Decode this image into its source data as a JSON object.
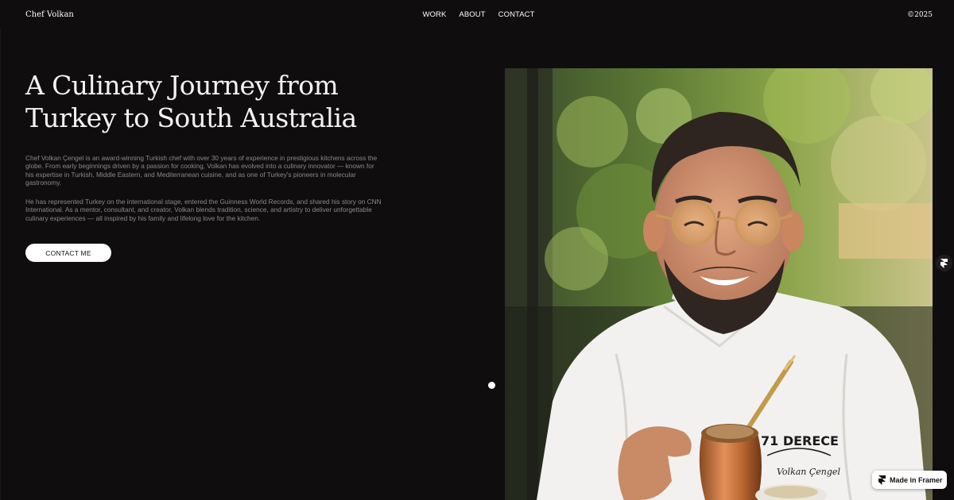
{
  "header": {
    "brand": "Chef Volkan",
    "nav": [
      "WORK",
      "ABOUT",
      "CONTACT"
    ],
    "year": "©2025"
  },
  "hero": {
    "title_line1": "A Culinary Journey from",
    "title_line2": "Turkey to South Australia",
    "bio_paragraph_1": "Chef Volkan Çengel is an award-winning Turkish chef with over 30 years of experience in prestigious kitchens across the globe. From early beginnings driven by a passion for cooking, Volkan has evolved into a culinary innovator — known for his expertise in Turkish, Middle Eastern, and Mediterranean cuisine, and as one of Turkey's pioneers in molecular gastronomy.",
    "bio_paragraph_2": "He has represented Turkey on the international stage, entered the Guinness World Records, and shared his story on CNN International. As a mentor, consultant, and creator, Volkan blends tradition, science, and artistry to deliver unforgettable culinary experiences — all inspired by his family and lifelong love for the kitchen.",
    "cta_label": "CONTACT ME"
  },
  "photo": {
    "jacket_logo_text": "71 DERECE",
    "jacket_name_text": "Volkan Çengel"
  },
  "badge": {
    "label": "Made in Framer",
    "icon": "framer-logo-icon"
  },
  "colors": {
    "background": "#0f0d0e",
    "text": "#ffffff",
    "muted_text": "#8b898a",
    "button_bg": "#ffffff"
  }
}
